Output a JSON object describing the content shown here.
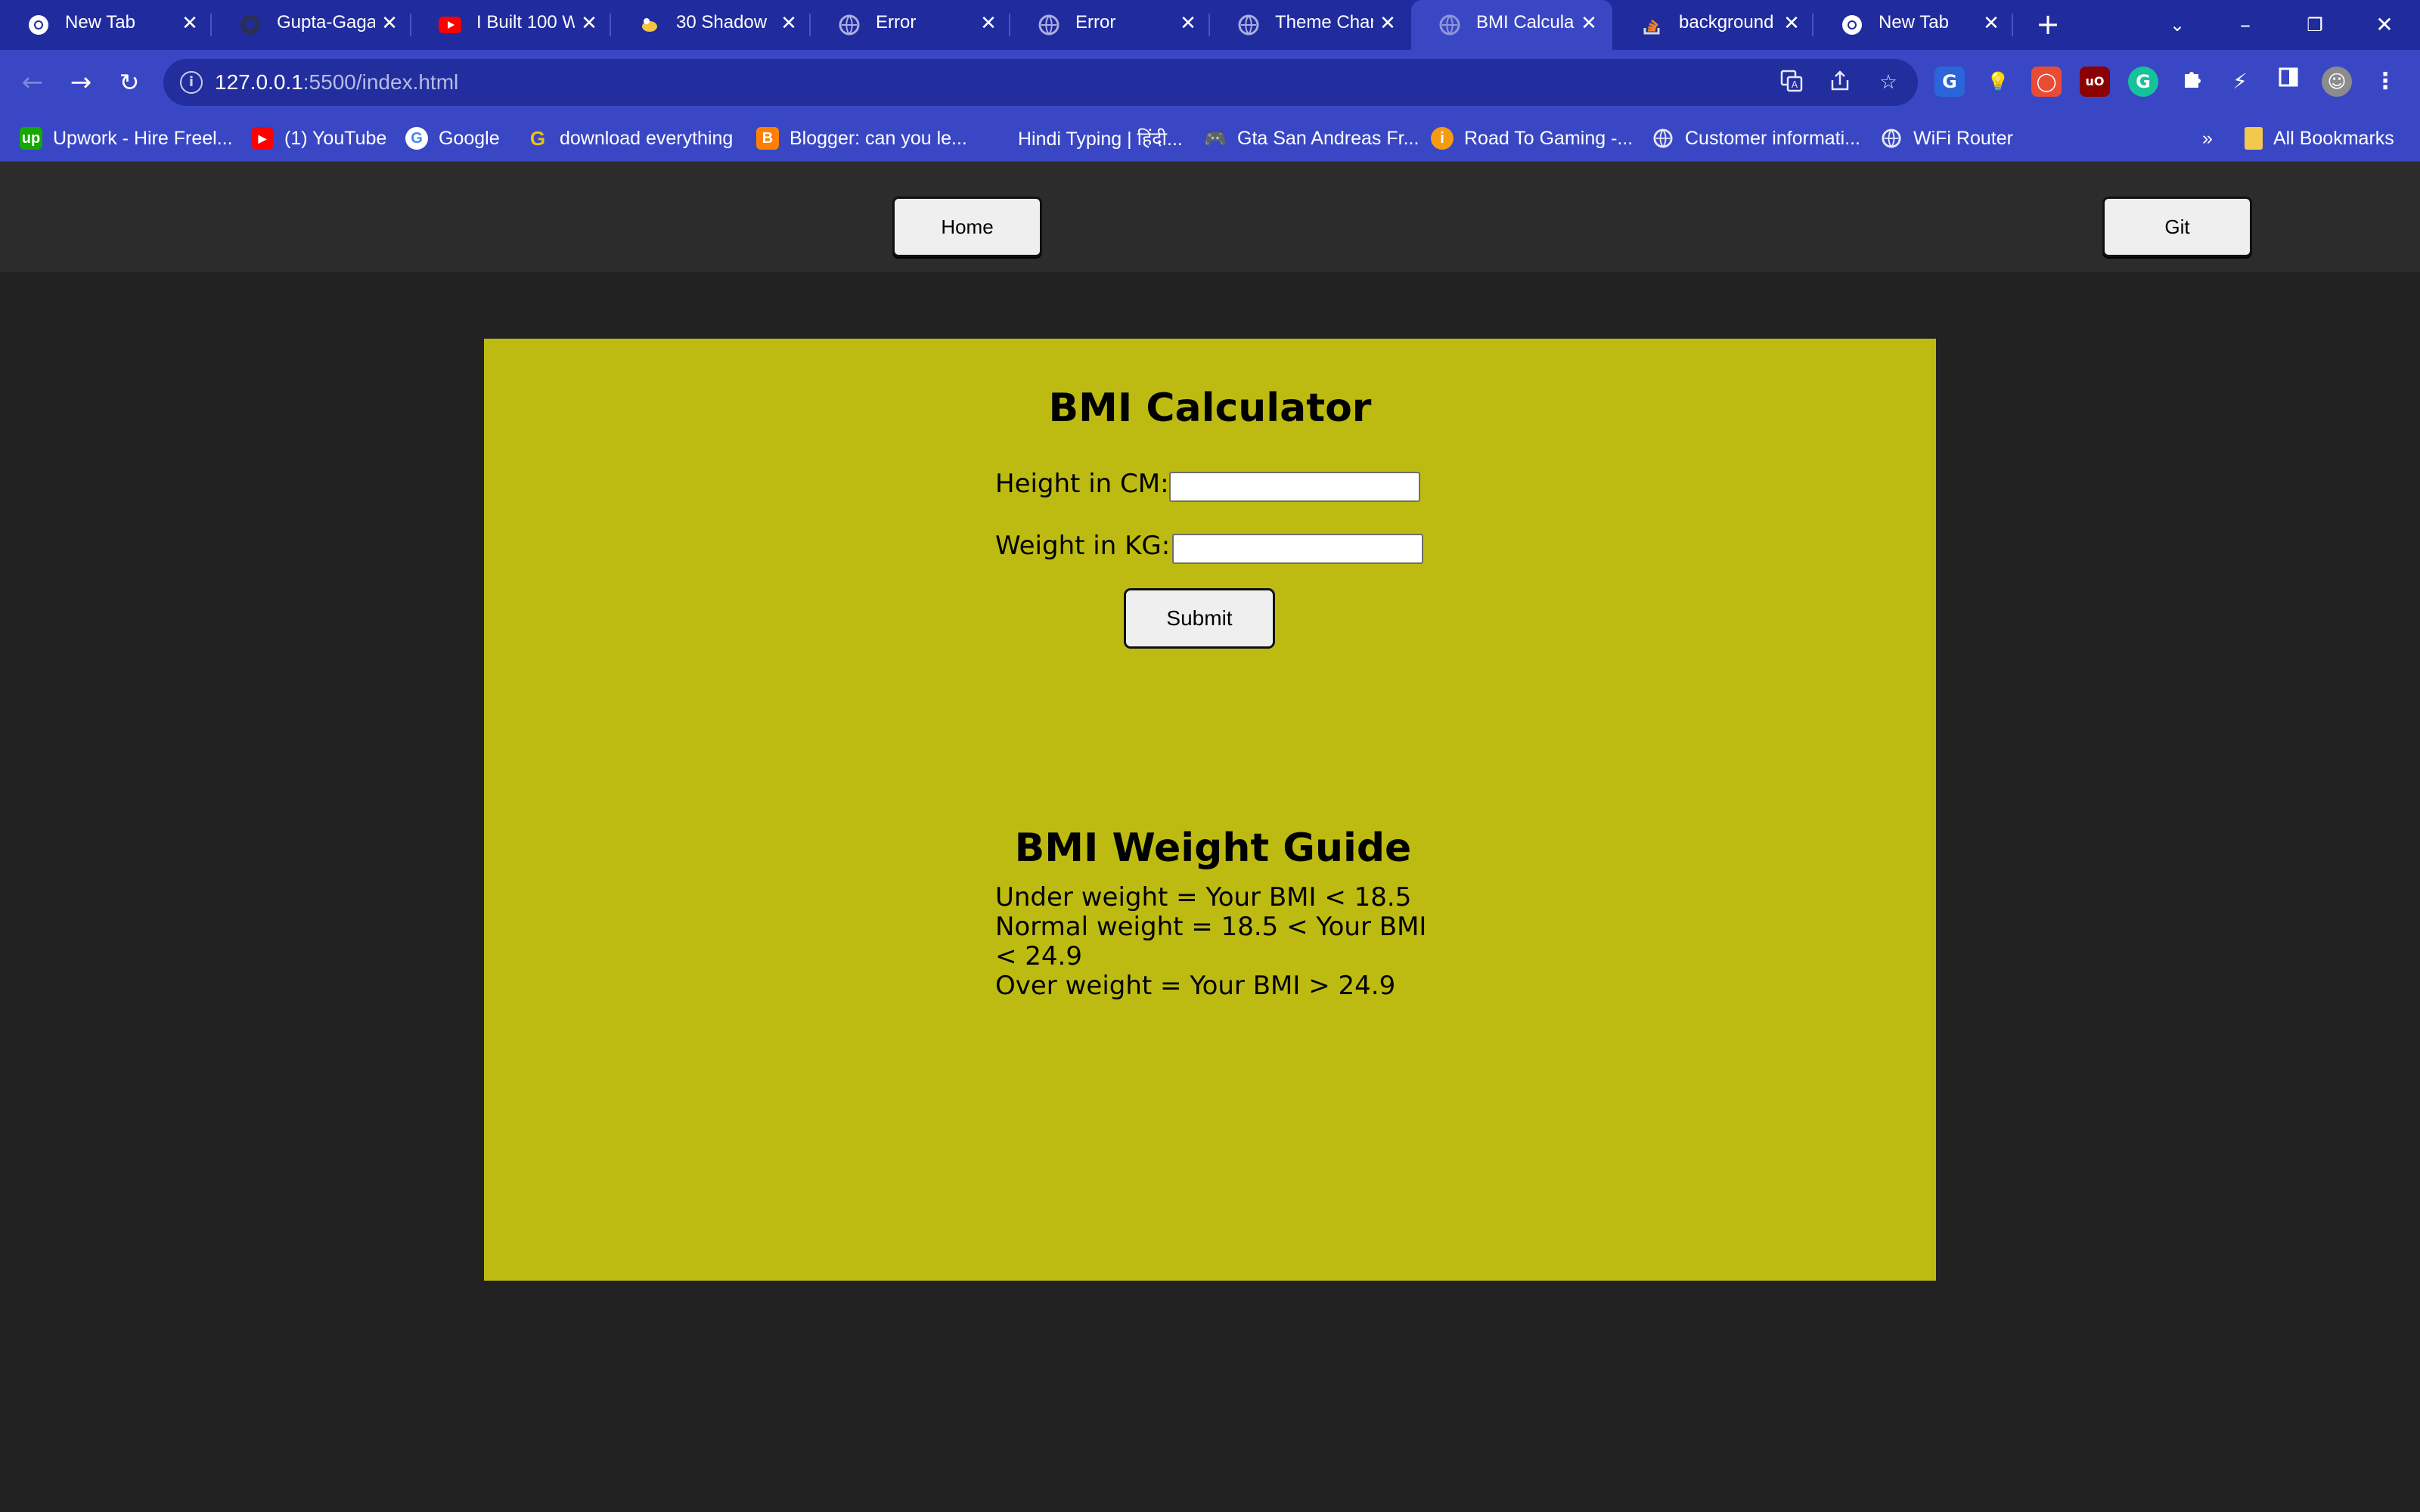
{
  "tabs": [
    {
      "title": "New Tab",
      "icon": "chrome-icon"
    },
    {
      "title": "Gupta-Gaga",
      "icon": "github-icon"
    },
    {
      "title": "I Built 100 W",
      "icon": "youtube-icon"
    },
    {
      "title": "30 Shadow",
      "icon": "css-icon"
    },
    {
      "title": "Error",
      "icon": "globe-icon"
    },
    {
      "title": "Error",
      "icon": "globe-icon"
    },
    {
      "title": "Theme Char",
      "icon": "globe-icon"
    },
    {
      "title": "BMI Calcula",
      "icon": "globe-icon",
      "active": true
    },
    {
      "title": "background",
      "icon": "stackoverflow-icon"
    },
    {
      "title": "New Tab",
      "icon": "chrome-icon"
    }
  ],
  "address_bar": {
    "url_host": "127.0.0.1",
    "url_rest": ":5500/index.html"
  },
  "bookmarks": [
    {
      "label": "Upwork - Hire Freel...",
      "icon": "upwork-icon"
    },
    {
      "label": "(1) YouTube",
      "icon": "youtube-icon"
    },
    {
      "label": "Google",
      "icon": "google-icon"
    },
    {
      "label": "download everything",
      "icon": "g-icon"
    },
    {
      "label": "Blogger: can you le...",
      "icon": "blogger-icon"
    },
    {
      "label": "Hindi Typing | हिंदी...",
      "icon": "blank-icon"
    },
    {
      "label": "Gta San Andreas Fr...",
      "icon": "gamepad-icon"
    },
    {
      "label": "Road To Gaming -...",
      "icon": "info-orange-icon"
    },
    {
      "label": "Customer informati...",
      "icon": "globe-icon"
    },
    {
      "label": "WiFi Router",
      "icon": "globe-icon"
    }
  ],
  "bookmarks_overflow": "»",
  "all_bookmarks_label": "All Bookmarks",
  "page": {
    "nav": {
      "home_label": "Home",
      "git_label": "Git"
    },
    "calculator": {
      "title": "BMI Calculator",
      "height_label": "Height in CM:",
      "height_value": "",
      "weight_label": "Weight in KG:",
      "weight_value": "",
      "submit_label": "Submit"
    },
    "guide": {
      "title": "BMI Weight Guide",
      "lines": [
        "Under weight = Your BMI < 18.5",
        "Normal weight = 18.5 < Your BMI",
        "< 24.9",
        "Over weight = Your BMI > 24.9"
      ]
    }
  },
  "colors": {
    "chrome_accent": "#3a47c4",
    "card_background": "#bdbb12",
    "page_background": "#222222"
  }
}
